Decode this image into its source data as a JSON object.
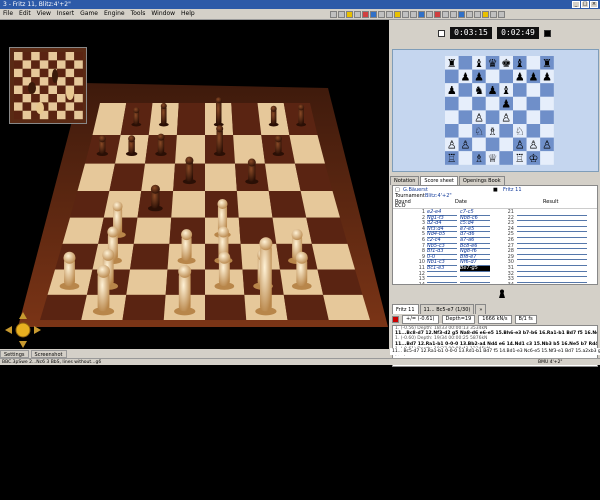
{
  "window": {
    "title": "3 - Fritz 11, Blitz:4'+2\""
  },
  "menu": [
    "File",
    "Edit",
    "View",
    "Insert",
    "Game",
    "Engine",
    "Tools",
    "Window",
    "Help"
  ],
  "clocks": {
    "white": "0:03:15",
    "black": "0:02:49"
  },
  "notation_tabs": [
    "Notation",
    "Score sheet",
    "Openings Book"
  ],
  "header": {
    "white_player": "G.Bäuerst",
    "black_player": "Fritz 11",
    "event_label": "Tournament",
    "event": "Blitz:4'+2\"",
    "round_label": "Round",
    "date_label": "Date",
    "result_label": "Result",
    "eco_label": "ECO"
  },
  "moves": [
    {
      "n": "1",
      "w": "e2-e4",
      "b": "c7-c5",
      "n2": "21"
    },
    {
      "n": "2",
      "w": "Ng1-f3",
      "b": "Nb8-c6",
      "n2": "22"
    },
    {
      "n": "3",
      "w": "d2-d4",
      "b": "c5:d4",
      "n2": "23"
    },
    {
      "n": "4",
      "w": "Nf3:d4",
      "b": "e7-e5",
      "n2": "24"
    },
    {
      "n": "5",
      "w": "Nd4-b5",
      "b": "d7-d6",
      "n2": "25"
    },
    {
      "n": "6",
      "w": "c2-c4",
      "b": "a7-a6",
      "n2": "26"
    },
    {
      "n": "7",
      "w": "Nb5-c3",
      "b": "Bc8-e6",
      "n2": "27"
    },
    {
      "n": "8",
      "w": "Bf1-d3",
      "b": "Ng8-f6",
      "n2": "28"
    },
    {
      "n": "9",
      "w": "0-0",
      "b": "Bf8-e7",
      "n2": "29"
    },
    {
      "n": "10",
      "w": "Nb1-c3",
      "b": "Nf6-d7",
      "n2": "30"
    },
    {
      "n": "11",
      "w": "Bc1-e3",
      "b": "Be7-g5",
      "n2": "31"
    },
    {
      "n": "12",
      "w": "",
      "b": "",
      "n2": "32"
    },
    {
      "n": "13",
      "w": "",
      "b": "",
      "n2": "33"
    },
    {
      "n": "14",
      "w": "",
      "b": "",
      "n2": "34"
    },
    {
      "n": "15",
      "w": "",
      "b": "",
      "n2": "35"
    },
    {
      "n": "16",
      "w": "",
      "b": "",
      "n2": "36"
    },
    {
      "n": "17",
      "w": "",
      "b": "",
      "n2": "37"
    },
    {
      "n": "18",
      "w": "",
      "b": "",
      "n2": "38"
    },
    {
      "n": "19",
      "w": "",
      "b": "",
      "n2": "39"
    },
    {
      "n": "20",
      "w": "",
      "b": "",
      "n2": "40"
    }
  ],
  "engine": {
    "tab_name": "Fritz 11",
    "line_label": "11... Bc5-e7 (1/30)",
    "eval": "+/= (-0.61)",
    "depth": "Depth=19",
    "speed": "1666 kN/s",
    "extra": "B/1 fs"
  },
  "analysis_lines": [
    "1. (-0.56) Depth: 18/33 00:00:13 3534kN",
    "11...Bc8-d7 12.Nf3-d2 g5 Na8-d6 e6-e5 15.Bh6-e3 b7-b6 16.Ra1-b1 Bd7 f5 16.Ne1-g4",
    "1. (-0.60) Depth: 19/34 00:00:25 5876kN",
    "11...Bd7 12.Ra1-b1 0-0-0 13.Bb2-a4 Nd4 e6 14.Nd1 c3 15.Nb3 b5 16.Ne5 b7 Rd4 16.Bb4 e2",
    "1. (-0.61) Depth: 19/37 00:00:41 12345kN",
    "[-/+]"
  ],
  "pv_line": "11... Bc5-d7 12.Ra1-b1 0-0-0 13.Rd1-b1 Bd7 f5 14.Bd1-e3 Nc6-e5 15.Nf3-e1 Bd7 15.a2xb3 g7-g5",
  "bottom_tabs": [
    "Settings",
    "Screenshot"
  ],
  "status": {
    "left": "BBC.3pSwe 2...Nc6 3 BbS, lines without...g6",
    "right": "BMU 4'+2\""
  },
  "colors": {
    "titlebar": "#2d5aa8",
    "light_square": "#e6c89a",
    "dark_square": "#5a2412",
    "mini_light": "#e6eefb",
    "mini_dark": "#6f8fc9"
  }
}
